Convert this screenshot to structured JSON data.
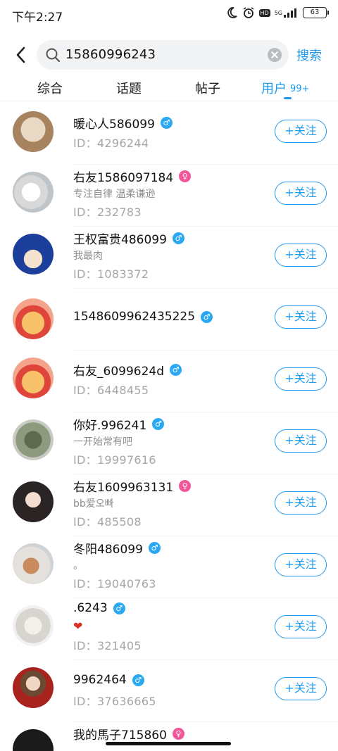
{
  "status_bar": {
    "time": "下午2:27",
    "network": "5G",
    "hd": "HD",
    "battery": "63"
  },
  "search": {
    "query": "15860996243",
    "button_label": "搜索"
  },
  "tabs": [
    {
      "label": "综合"
    },
    {
      "label": "话题"
    },
    {
      "label": "帖子"
    },
    {
      "label": "用户",
      "badge": "99+"
    }
  ],
  "users": [
    {
      "name": "暖心人586099",
      "gender": "male",
      "bio": "",
      "id": "ID：4296244",
      "follow": "+关注"
    },
    {
      "name": "右友1586097184",
      "gender": "female",
      "bio": "专注自律 温柔谦逊",
      "id": "ID：232783",
      "follow": "+关注"
    },
    {
      "name": "王权富贵486099",
      "gender": "male",
      "bio": "我最肉",
      "id": "ID：1083372",
      "follow": "+关注"
    },
    {
      "name": "1548609962435225",
      "gender": "male",
      "bio": "",
      "id": "",
      "follow": "+关注"
    },
    {
      "name": "右友_6099624d",
      "gender": "male",
      "bio": "",
      "id": "ID：6448455",
      "follow": "+关注"
    },
    {
      "name": "你好.996241",
      "gender": "male",
      "bio": "一开始常有吧",
      "id": "ID：19997616",
      "follow": "+关注"
    },
    {
      "name": "右友1609963131",
      "gender": "female",
      "bio": "bb爱오빠",
      "id": "ID：485508",
      "follow": "+关注"
    },
    {
      "name": "冬阳486099",
      "gender": "male",
      "bio": "。",
      "id": "ID：19040763",
      "follow": "+关注"
    },
    {
      "name": ".6243",
      "gender": "male",
      "bio": "❤",
      "id": "ID：321405",
      "follow": "+关注"
    },
    {
      "name": "9962464",
      "gender": "male",
      "bio": "",
      "id": "ID：37636665",
      "follow": "+关注"
    },
    {
      "name": "我的馬子715860",
      "gender": "female",
      "bio": "",
      "id": "",
      "follow": ""
    }
  ],
  "colors": {
    "accent": "#1f9bf0",
    "male": "#2aa8f2",
    "female": "#f2559a"
  },
  "icons": [
    "back-arrow-icon",
    "search-icon",
    "clear-icon",
    "moon-icon",
    "alarm-icon",
    "signal-icon",
    "battery-icon"
  ]
}
